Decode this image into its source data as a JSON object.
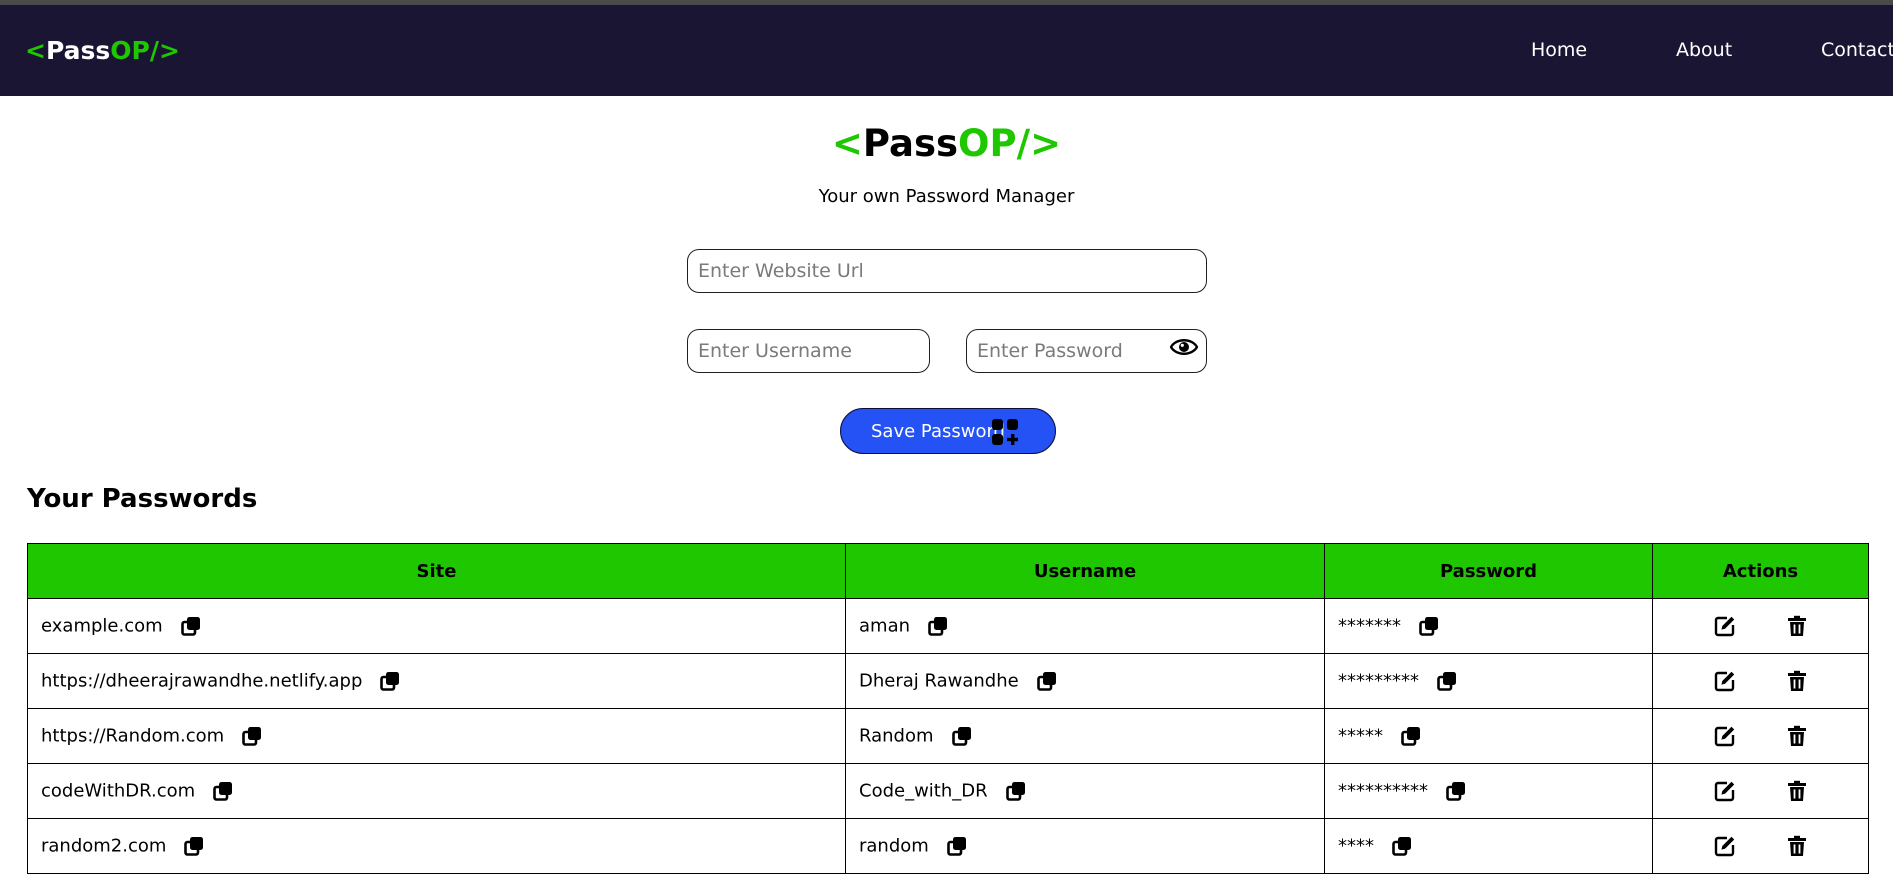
{
  "nav": {
    "brand": {
      "open": "<",
      "part1": "Pass",
      "part2": "OP/>"
    },
    "links": [
      {
        "label": "Home"
      },
      {
        "label": "About"
      },
      {
        "label": "Contact"
      }
    ]
  },
  "hero": {
    "brand": {
      "open": "<",
      "part1": "Pass",
      "part2": "OP/>"
    },
    "subtitle": "Your own Password Manager"
  },
  "form": {
    "site_placeholder": "Enter Website Url",
    "username_placeholder": "Enter Username",
    "password_placeholder": "Enter Password",
    "save_label": "Save Password"
  },
  "passwords": {
    "title": "Your Passwords",
    "columns": [
      "Site",
      "Username",
      "Password",
      "Actions"
    ],
    "rows": [
      {
        "site": "example.com",
        "username": "aman",
        "password": "*******"
      },
      {
        "site": "https://dheerajrawandhe.netlify.app",
        "username": "Dheraj Rawandhe",
        "password": "*********"
      },
      {
        "site": "https://Random.com",
        "username": "Random",
        "password": "*****"
      },
      {
        "site": "codeWithDR.com",
        "username": "Code_with_DR",
        "password": "**********"
      },
      {
        "site": "random2.com",
        "username": "random",
        "password": "****"
      }
    ]
  },
  "colors": {
    "navbar": "#1b1534",
    "accent_green": "#1ec700",
    "button_blue": "#2452f5"
  }
}
